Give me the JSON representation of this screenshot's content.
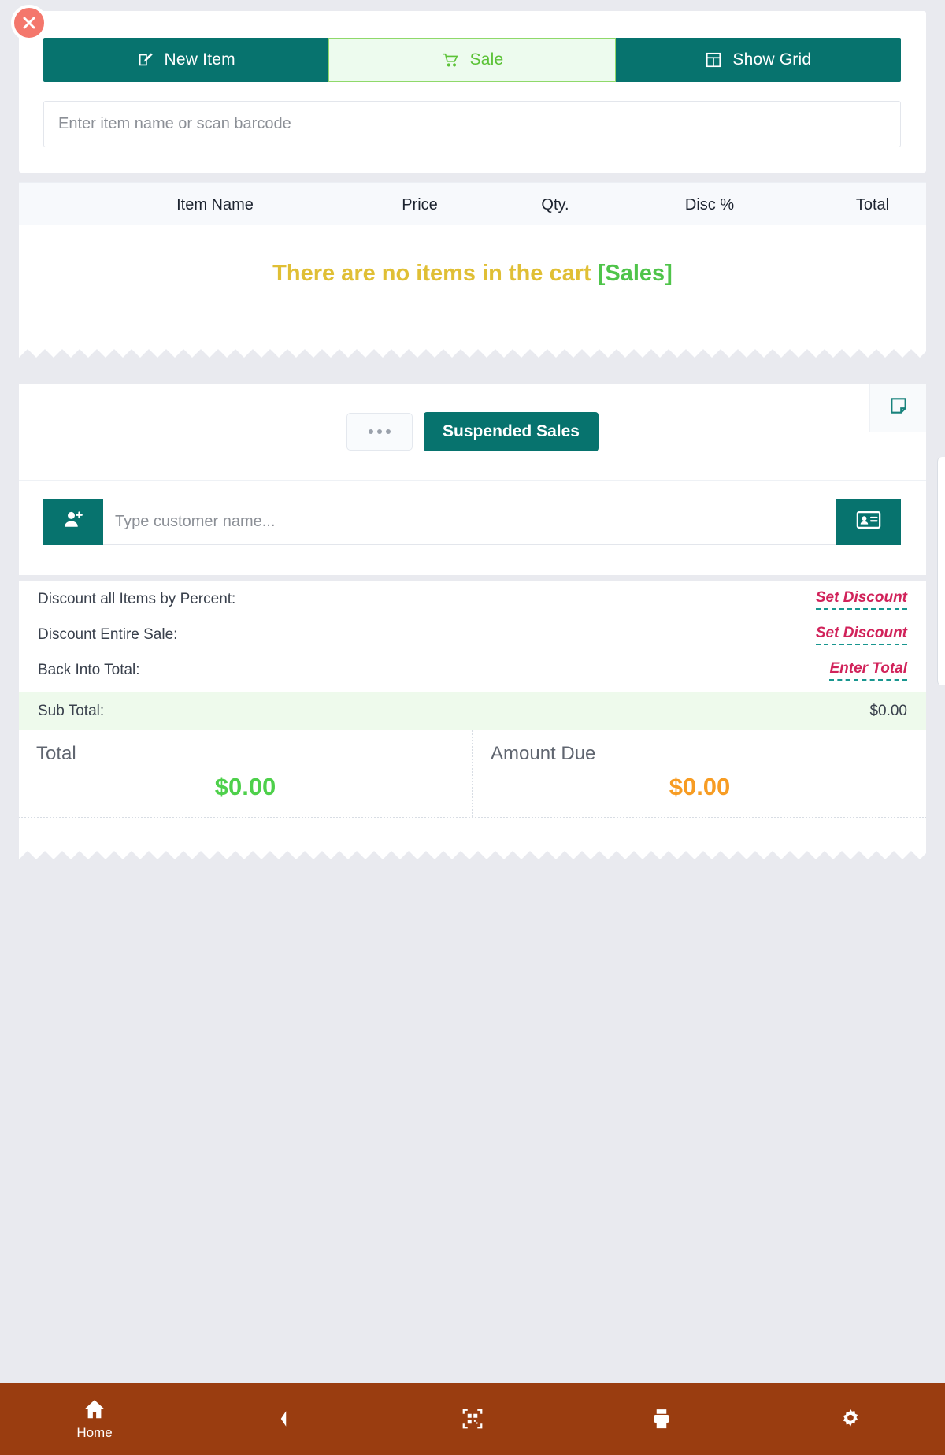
{
  "window": {
    "close_icon": "close-icon"
  },
  "tabs": [
    {
      "label": "New Item",
      "icon": "pencil-square-icon",
      "state": "inactive"
    },
    {
      "label": "Sale",
      "icon": "shopping-cart-icon",
      "state": "active"
    },
    {
      "label": "Show Grid",
      "icon": "grid-layout-icon",
      "state": "inactive"
    }
  ],
  "search": {
    "placeholder": "Enter item name or scan barcode",
    "value": ""
  },
  "cart": {
    "columns": [
      "Item Name",
      "Price",
      "Qty.",
      "Disc %",
      "Total"
    ],
    "empty_message": "There are no items in the cart",
    "empty_context": "[Sales]"
  },
  "actions": {
    "note_icon": "sticky-note-icon",
    "more_label": "•••",
    "suspended_label": "Suspended Sales"
  },
  "customer": {
    "add_icon": "person-add-icon",
    "placeholder": "Type customer name...",
    "value": "",
    "card_icon": "id-card-icon"
  },
  "discounts": [
    {
      "label": "Discount all Items by Percent:",
      "action": "Set Discount"
    },
    {
      "label": "Discount Entire Sale:",
      "action": "Set Discount"
    },
    {
      "label": "Back Into Total:",
      "action": "Enter Total"
    }
  ],
  "subtotal": {
    "label": "Sub Total:",
    "value": "$0.00"
  },
  "grand": {
    "total_label": "Total",
    "total_value": "$0.00",
    "due_label": "Amount Due",
    "due_value": "$0.00"
  },
  "bottom_nav": [
    {
      "label": "Home",
      "icon": "home-icon"
    },
    {
      "label": "",
      "icon": "back-chevron-icon"
    },
    {
      "label": "",
      "icon": "qr-scan-icon"
    },
    {
      "label": "",
      "icon": "printer-icon"
    },
    {
      "label": "",
      "icon": "gear-icon"
    }
  ],
  "colors": {
    "teal": "#07736e",
    "green_accent": "#5bc236",
    "yellow": "#e0bf35",
    "crimson": "#d1225a",
    "orange": "#f79c23",
    "nav_brown": "#9a3d10",
    "close_red": "#f4776c"
  }
}
